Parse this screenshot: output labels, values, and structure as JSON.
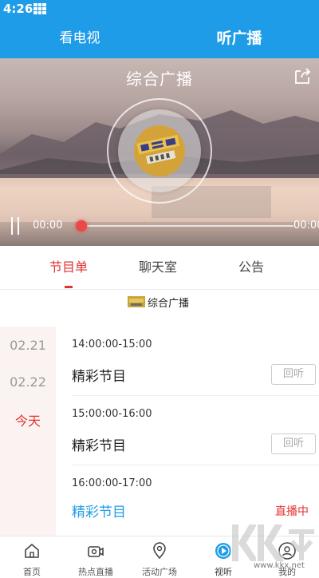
{
  "status_bar": {
    "time": "4:26"
  },
  "header": {
    "tabs": [
      {
        "label": "看电视"
      },
      {
        "label": "听广播"
      }
    ]
  },
  "player": {
    "station_title": "综合广播",
    "elapsed": "00:00",
    "duration": "00:00",
    "progress": 0
  },
  "sub_tabs": [
    {
      "label": "节目单"
    },
    {
      "label": "聊天室"
    },
    {
      "label": "公告"
    }
  ],
  "station_row": {
    "name": "综合广播"
  },
  "dates": [
    {
      "label": "02.21"
    },
    {
      "label": "02.22"
    },
    {
      "label": "今天"
    }
  ],
  "programs": [
    {
      "time": "14:00:00-15:00",
      "title": "精彩节目",
      "action": "回听"
    },
    {
      "time": "15:00:00-16:00",
      "title": "精彩节目",
      "action": "回听"
    },
    {
      "time": "16:00:00-17:00",
      "title": "精彩节目",
      "status": "直播中"
    }
  ],
  "bottom_nav": [
    {
      "label": "首页",
      "icon": "home-icon"
    },
    {
      "label": "热点直播",
      "icon": "live-camera-icon"
    },
    {
      "label": "活动广场",
      "icon": "location-pin-icon"
    },
    {
      "label": "视听",
      "icon": "play-circle-icon"
    },
    {
      "label": "我的",
      "icon": "user-icon"
    }
  ],
  "colors": {
    "accent": "#1e9ce8",
    "active": "#e2322f"
  },
  "watermark": {
    "text": "www.kkx.net"
  }
}
